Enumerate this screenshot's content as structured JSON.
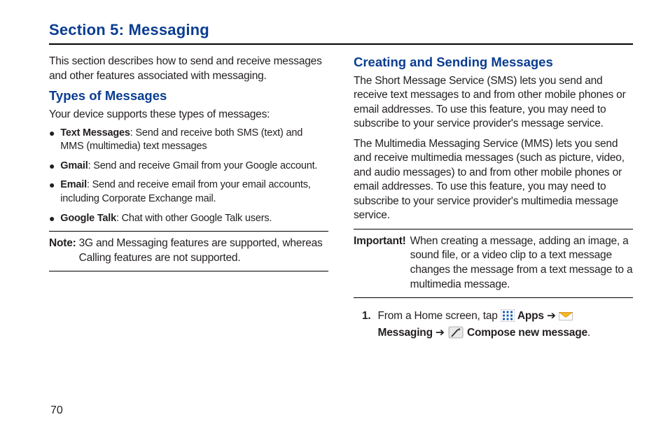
{
  "section_title": "Section 5: Messaging",
  "page_number": "70",
  "col1": {
    "intro": "This section describes how to send and receive messages and other features associated with messaging.",
    "types_heading": "Types of Messages",
    "types_intro": "Your device supports these types of messages:",
    "bullets": [
      {
        "label": "Text Messages",
        "desc": ": Send and receive both SMS (text) and MMS (multimedia) text messages"
      },
      {
        "label": "Gmail",
        "desc": ": Send and receive Gmail from your Google account."
      },
      {
        "label": "Email",
        "desc": ": Send and receive email from your email accounts, including Corporate Exchange mail."
      },
      {
        "label": "Google Talk",
        "desc": ": Chat with other Google Talk users."
      }
    ],
    "note_label": "Note:",
    "note_text": "3G and Messaging features are supported, whereas Calling features are not supported."
  },
  "col2": {
    "create_heading": "Creating and Sending Messages",
    "para1": "The Short Message Service (SMS) lets you send and receive text messages to and from other mobile phones or email addresses. To use this feature, you may need to subscribe to your service provider's message service.",
    "para2": "The Multimedia Messaging Service (MMS) lets you send and receive multimedia messages (such as picture, video, and audio messages) to and from other mobile phones or email addresses. To use this feature, you may need to subscribe to your service provider's multimedia message service.",
    "important_label": "Important!",
    "important_text": "When creating a message, adding an image, a sound file, or a video clip to a text message changes the message from a text message to a multimedia message.",
    "step_number": "1.",
    "step_prefix": "From a Home screen, tap ",
    "apps_label": " Apps ",
    "arrow": "➔",
    "messaging_label": "Messaging ",
    "compose_label": " Compose new message",
    "period": "."
  }
}
